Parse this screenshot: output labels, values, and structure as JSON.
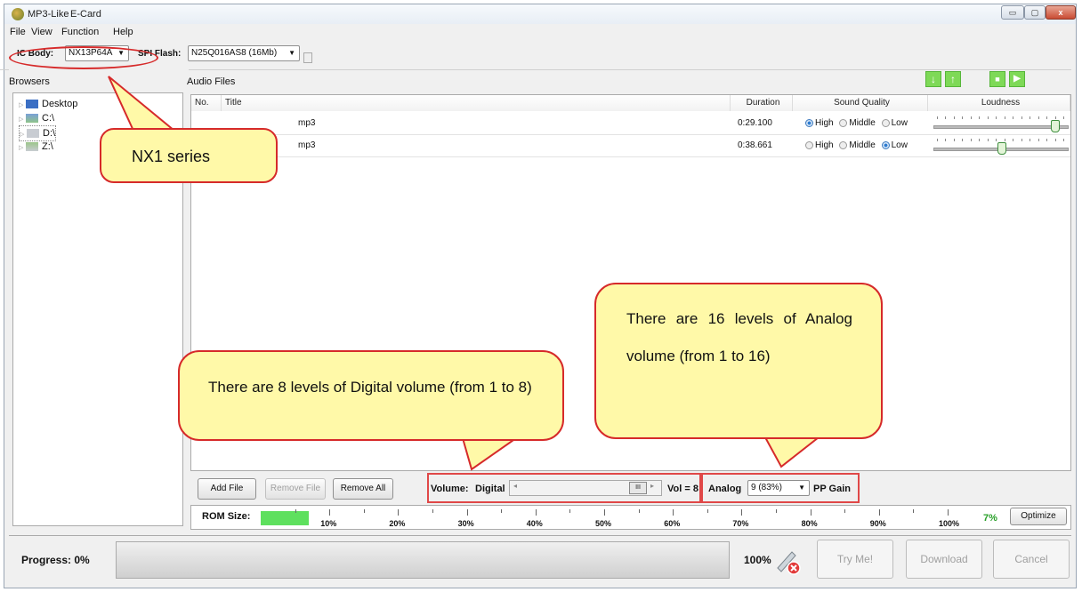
{
  "window": {
    "app_name": "MP3-Like",
    "subtitle": "E-Card",
    "min": "▭",
    "max": "▢",
    "close": "x"
  },
  "menu": [
    "File",
    "View",
    "Function",
    "Help"
  ],
  "toolbar": {
    "ic_body_label": "IC Body:",
    "ic_body_value": "NX13P64A",
    "spi_flash_label": "SPI Flash:",
    "spi_flash_value": "N25Q016AS8 (16Mb)"
  },
  "browsers": {
    "label": "Browsers",
    "items": [
      {
        "label": "Desktop",
        "icon": "desktop-icon"
      },
      {
        "label": "C:\\",
        "icon": "drive-icon"
      },
      {
        "label": "D:\\",
        "icon": "drive-icon"
      },
      {
        "label": "Z:\\",
        "icon": "network-drive-icon"
      }
    ]
  },
  "audio": {
    "label": "Audio Files",
    "columns": [
      "No.",
      "Title",
      "Duration",
      "Sound Quality",
      "Loudness"
    ],
    "rows": [
      {
        "title": "mp3",
        "duration": "0:29.100",
        "quality": "High",
        "loudness": 0.93
      },
      {
        "title": "mp3",
        "duration": "0:38.661",
        "quality": "Low",
        "loudness": 0.51
      }
    ],
    "quality_options": [
      "High",
      "Middle",
      "Low"
    ]
  },
  "controls": {
    "add_file": "Add File",
    "remove_file": "Remove File",
    "remove_all": "Remove All",
    "volume_label": "Volume:",
    "digital_label": "Digital",
    "vol_text": "Vol = 8",
    "analog_label": "Analog",
    "analog_value": "9 (83%)",
    "pp_gain": "PP Gain"
  },
  "rom": {
    "label": "ROM Size:",
    "ticks": [
      "10%",
      "20%",
      "30%",
      "40%",
      "50%",
      "60%",
      "70%",
      "80%",
      "90%",
      "100%"
    ],
    "used": "7%",
    "used_fraction": 0.07,
    "optimize": "Optimize"
  },
  "progress": {
    "label": "Progress:",
    "value": "0%",
    "percent": "100%",
    "try_me": "Try Me!",
    "download": "Download",
    "cancel": "Cancel"
  },
  "callouts": {
    "nx1": "NX1 series",
    "digital": "There are 8 levels of Digital volume (from 1 to 8)",
    "analog": "There are 16 levels of Analog volume (from 1 to 16)"
  },
  "colors": {
    "accent_green": "#5ee05e",
    "callout_fill": "#fff9a8",
    "callout_border": "#d62a2a"
  }
}
